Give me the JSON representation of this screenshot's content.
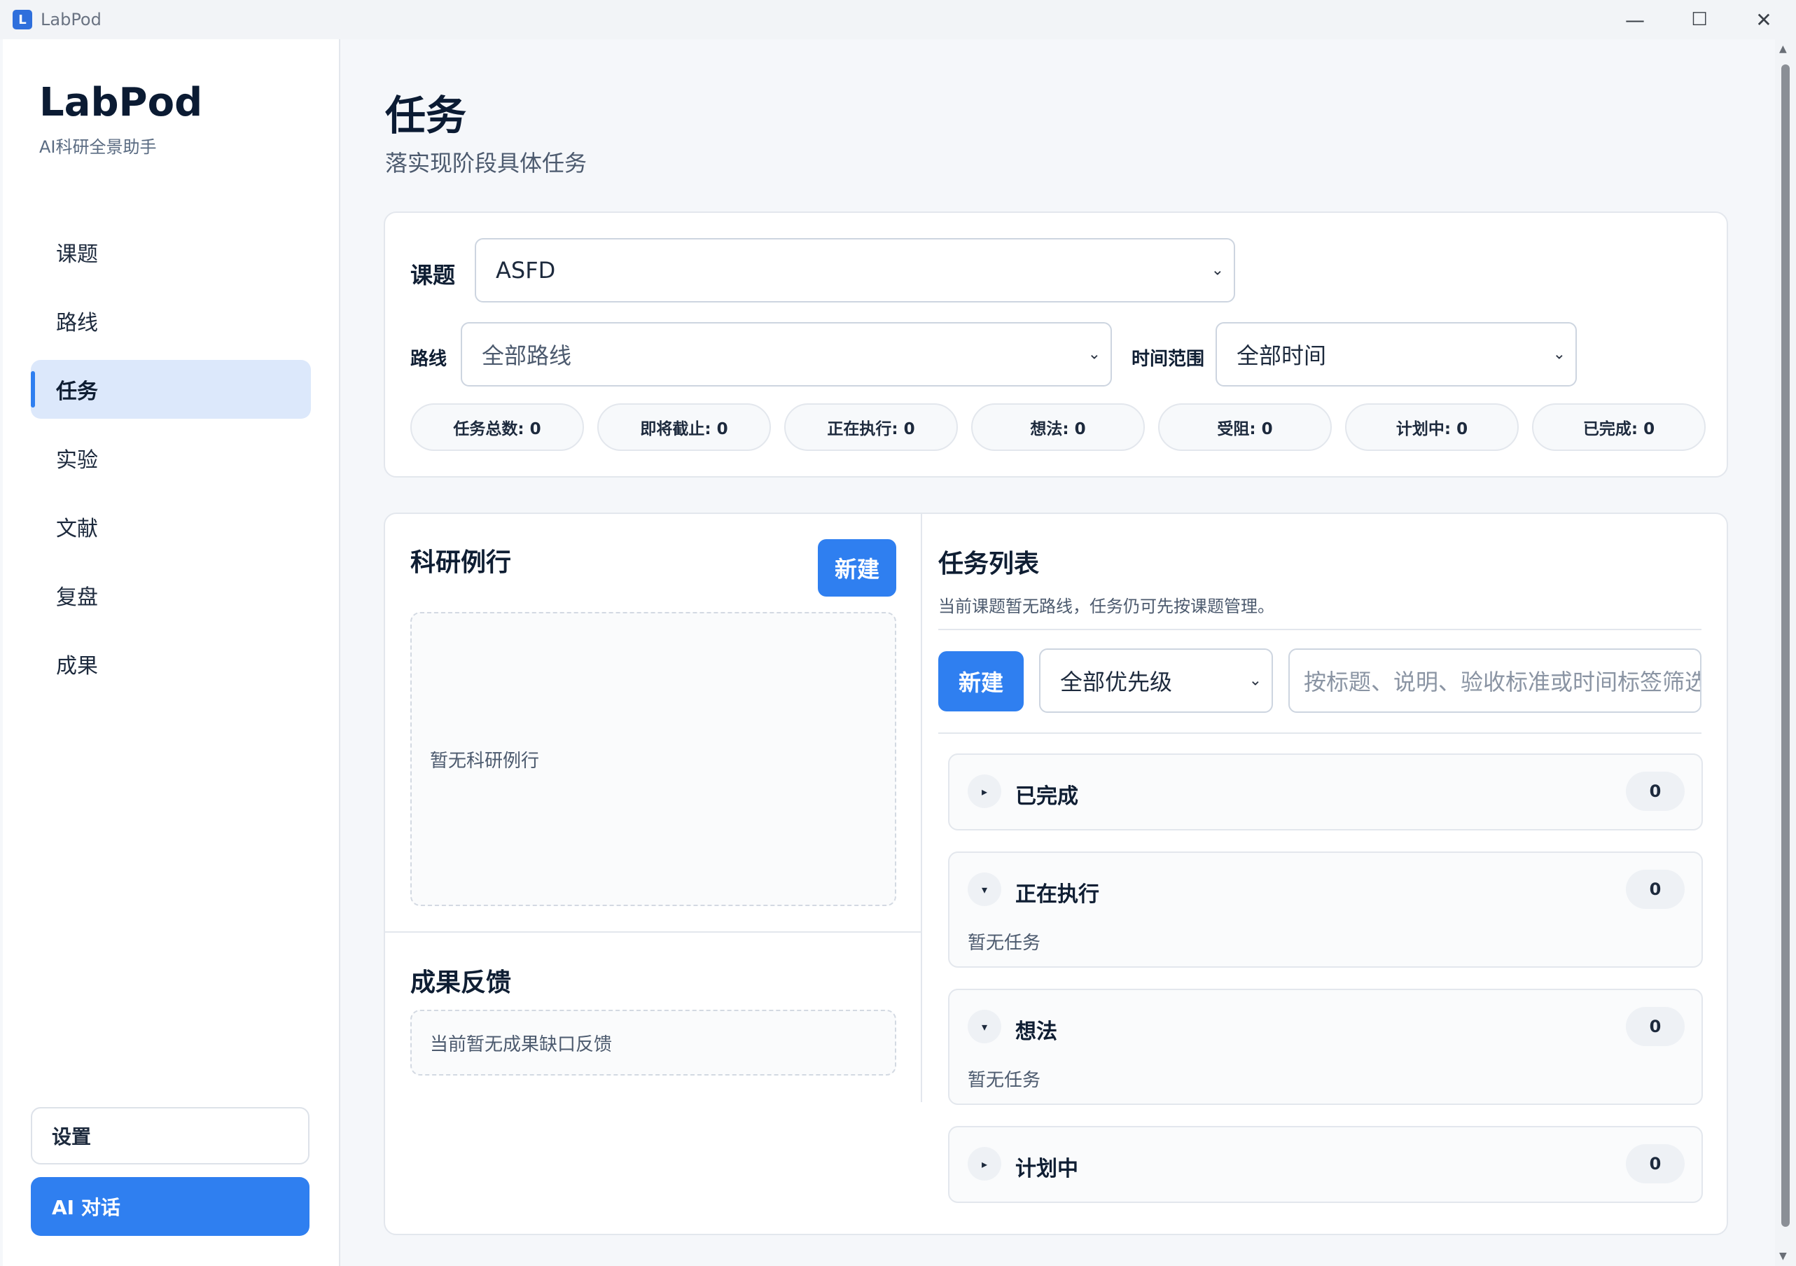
{
  "window": {
    "title": "LabPod"
  },
  "sidebar": {
    "brand": "LabPod",
    "subtitle": "AI科研全景助手",
    "items": [
      {
        "label": "课题"
      },
      {
        "label": "路线"
      },
      {
        "label": "任务",
        "active": true
      },
      {
        "label": "实验"
      },
      {
        "label": "文献"
      },
      {
        "label": "复盘"
      },
      {
        "label": "成果"
      }
    ],
    "settings_label": "设置",
    "ai_chat_label": "AI 对话"
  },
  "page": {
    "title": "任务",
    "subtitle": "落实现阶段具体任务"
  },
  "filters": {
    "topic_label": "课题",
    "topic_value": "ASFD",
    "route_label": "路线",
    "route_value": "全部路线",
    "time_label": "时间范围",
    "time_value": "全部时间"
  },
  "stats": [
    {
      "label": "任务总数: 0"
    },
    {
      "label": "即将截止: 0"
    },
    {
      "label": "正在执行: 0"
    },
    {
      "label": "想法: 0"
    },
    {
      "label": "受阻: 0"
    },
    {
      "label": "计划中: 0"
    },
    {
      "label": "已完成: 0"
    }
  ],
  "routine": {
    "title": "科研例行",
    "new_label": "新建",
    "empty_text": "暂无科研例行"
  },
  "feedback": {
    "title": "成果反馈",
    "empty_text": "当前暂无成果缺口反馈"
  },
  "tasks": {
    "title": "任务列表",
    "subtitle": "当前课题暂无路线，任务仍可先按课题管理。",
    "new_label": "新建",
    "priority_value": "全部优先级",
    "search_placeholder": "按标题、说明、验收标准或时间标签筛选",
    "groups": [
      {
        "name": "已完成",
        "count": "0",
        "expanded": false,
        "empty_text": ""
      },
      {
        "name": "正在执行",
        "count": "0",
        "expanded": true,
        "empty_text": "暂无任务"
      },
      {
        "name": "想法",
        "count": "0",
        "expanded": true,
        "empty_text": "暂无任务"
      },
      {
        "name": "计划中",
        "count": "0",
        "expanded": false,
        "empty_text": ""
      }
    ]
  },
  "icons": {
    "collapsed": "triangle-right-icon",
    "expanded": "triangle-down-icon",
    "dropdown": "chevron-down-icon"
  },
  "colors": {
    "accent": "#2f7ff0",
    "active_nav_bg": "#dce8fb"
  }
}
